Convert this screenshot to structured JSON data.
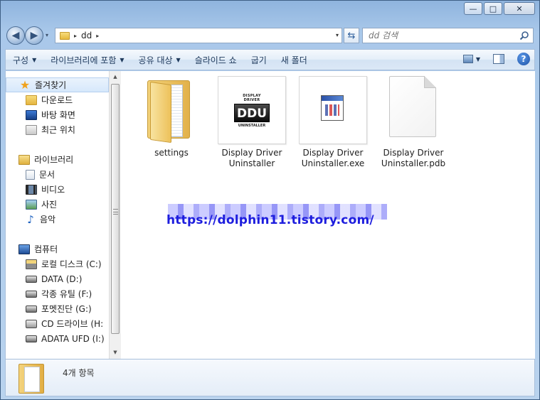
{
  "window": {
    "caption_minimize": "—",
    "caption_maximize": "□",
    "caption_close": "✕"
  },
  "address": {
    "path_separator": "▸",
    "current_folder": "dd",
    "dropdown_glyph": "▾",
    "refresh_glyph": "⇆"
  },
  "search": {
    "placeholder": "dd 검색"
  },
  "toolbar": {
    "items": [
      {
        "label": "구성",
        "has_dropdown": true
      },
      {
        "label": "라이브러리에 포함",
        "has_dropdown": true
      },
      {
        "label": "공유 대상",
        "has_dropdown": true
      },
      {
        "label": "슬라이드 쇼",
        "has_dropdown": false
      },
      {
        "label": "굽기",
        "has_dropdown": false
      },
      {
        "label": "새 폴더",
        "has_dropdown": false
      }
    ],
    "dropdown_glyph": "▼",
    "help_glyph": "?"
  },
  "navpane": {
    "favorites": {
      "label": "즐겨찾기",
      "icon": "star-icon"
    },
    "favorite_items": [
      {
        "label": "다운로드",
        "icon": "downloads-folder-icon"
      },
      {
        "label": "바탕 화면",
        "icon": "desktop-icon"
      },
      {
        "label": "최근 위치",
        "icon": "recent-places-icon"
      }
    ],
    "libraries": {
      "label": "라이브러리",
      "icon": "library-icon"
    },
    "library_items": [
      {
        "label": "문서",
        "icon": "documents-icon"
      },
      {
        "label": "비디오",
        "icon": "videos-icon"
      },
      {
        "label": "사진",
        "icon": "pictures-icon"
      },
      {
        "label": "음악",
        "icon": "music-icon"
      }
    ],
    "computer": {
      "label": "컴퓨터",
      "icon": "computer-icon"
    },
    "computer_items": [
      {
        "label": "로컬 디스크 (C:)",
        "icon": "system-drive-icon"
      },
      {
        "label": "DATA (D:)",
        "icon": "drive-icon"
      },
      {
        "label": "각종 유틸 (F:)",
        "icon": "drive-icon"
      },
      {
        "label": "포멧진단 (G:)",
        "icon": "drive-icon"
      },
      {
        "label": "CD 드라이브 (H:",
        "icon": "cd-drive-icon"
      },
      {
        "label": "ADATA UFD (I:)",
        "icon": "drive-icon"
      }
    ],
    "scroll_up": "▲",
    "scroll_down": "▼"
  },
  "files": [
    {
      "name": "settings",
      "type": "folder"
    },
    {
      "name": "Display Driver Uninstaller",
      "type": "application",
      "logo_top": "DISPLAY DRIVER",
      "logo_main": "DDU",
      "logo_bottom": "UNINSTALLER"
    },
    {
      "name": "Display Driver Uninstaller.exe",
      "type": "executable"
    },
    {
      "name": "Display Driver Uninstaller.pdb",
      "type": "file"
    }
  ],
  "watermark": "https://dolphin11.tistory.com/",
  "details": {
    "item_count": "4개 항목"
  }
}
